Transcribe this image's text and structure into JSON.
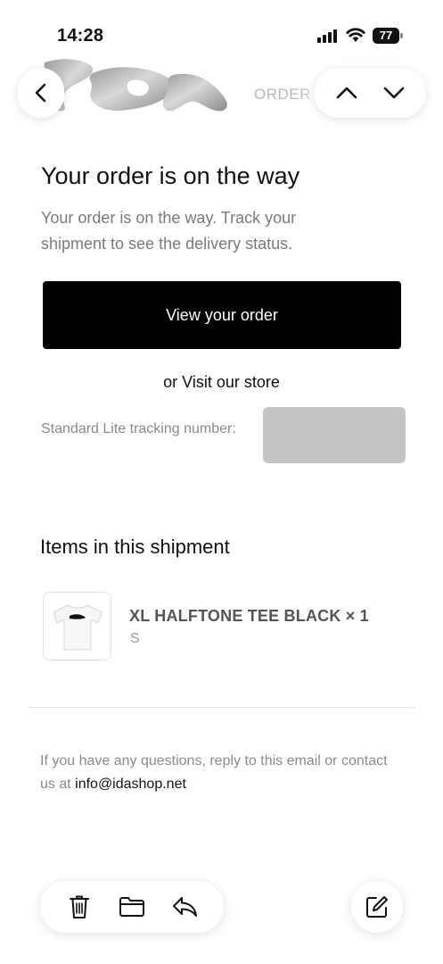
{
  "status_bar": {
    "time": "14:28",
    "battery": "77",
    "icons": [
      "cellular-signal-icon",
      "wifi-icon",
      "battery-icon"
    ]
  },
  "nav": {
    "title": "ORDER",
    "back_icon": "chevron-left-icon",
    "prev_icon": "chevron-up-icon",
    "next_icon": "chevron-down-icon",
    "logo_text": "IDA"
  },
  "email": {
    "headline": "Your order is on the way",
    "subtext": "Your order is on the way. Track your shipment to see the delivery status.",
    "cta_label": "View your order",
    "visit_prefix": "or ",
    "visit_link": "Visit our store",
    "tracking_label": "Standard Lite tracking number:",
    "items_heading": "Items in this shipment",
    "items": [
      {
        "name": "XL HALFTONE TEE BLACK × 1",
        "variant": "S"
      }
    ],
    "footer_text": "If you have any questions, reply to this email or contact us at ",
    "footer_email": "info@idashop.net"
  },
  "toolbar": {
    "icons": [
      "trash-icon",
      "folder-icon",
      "reply-icon",
      "compose-icon"
    ]
  },
  "colors": {
    "cta_background": "#000000",
    "cta_text": "#ffffff",
    "muted_text": "#7a7a7a",
    "redaction": "#c4c4c4"
  }
}
